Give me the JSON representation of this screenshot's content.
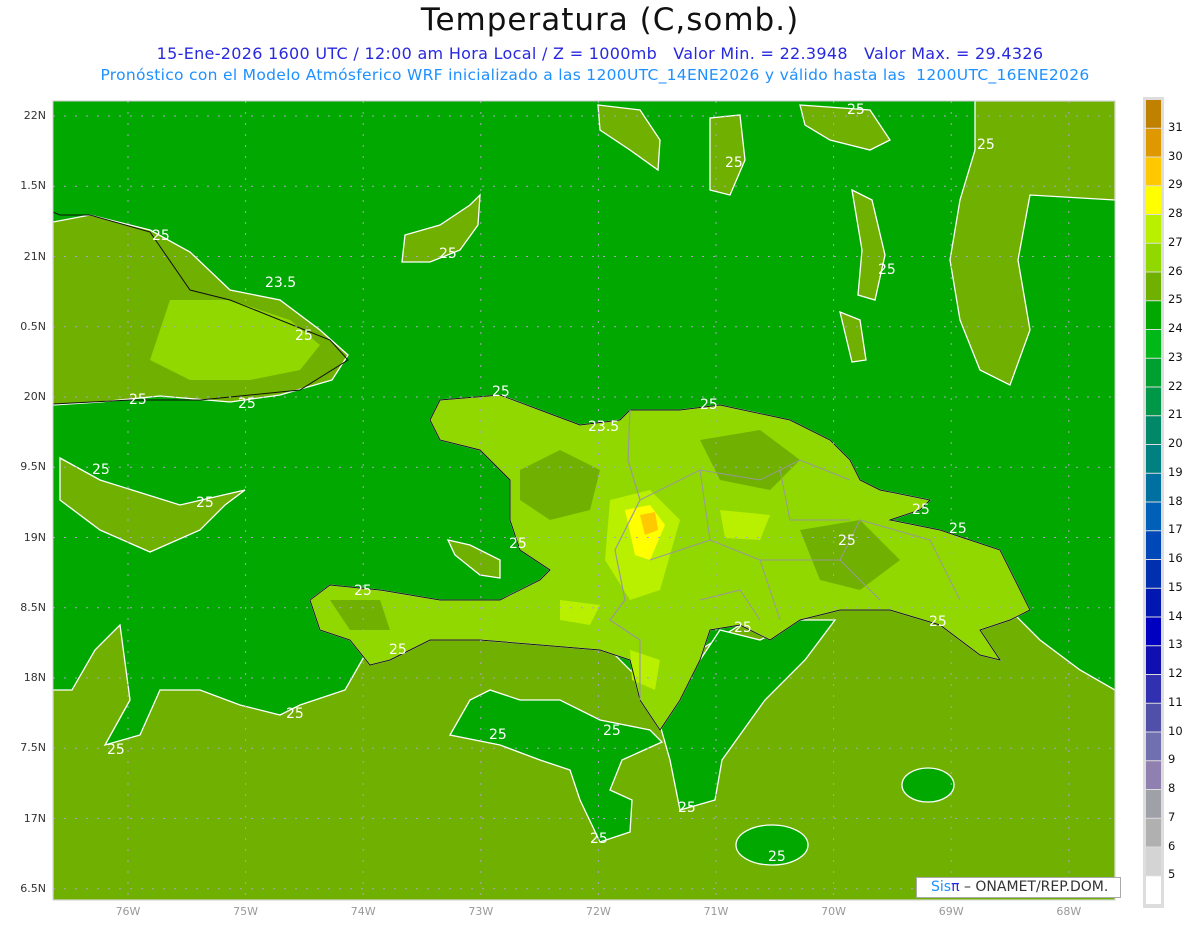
{
  "header": {
    "title": "Temperatura (C,somb.)",
    "line1": "15-Ene-2026 1600 UTC / 12:00 am Hora Local / Z = 1000mb   Valor Min. = 22.3948   Valor Max. = 29.4326",
    "line2": "Pronóstico con el Modelo Atmósferico WRF inicializado a las 1200UTC_14ENE2026 y válido hasta las  1200UTC_16ENE2026"
  },
  "map": {
    "lat_labels": [
      "22N",
      "1.5N",
      "21N",
      "0.5N",
      "20N",
      "9.5N",
      "19N",
      "8.5N",
      "18N",
      "7.5N",
      "17N",
      "6.5N"
    ],
    "lon_labels": [
      "76W",
      "75W",
      "74W",
      "73W",
      "72W",
      "71W",
      "70W",
      "69W",
      "68W"
    ],
    "contour_labels": [
      "25",
      "25",
      "25",
      "25",
      "25",
      "25",
      "25",
      "25",
      "25",
      "25",
      "25",
      "25",
      "25",
      "25",
      "25",
      "25",
      "25",
      "25",
      "25",
      "25",
      "25",
      "25",
      "25",
      "25",
      "25",
      "25",
      "25",
      "25",
      "23.5",
      "23.5"
    ],
    "colors": {
      "ocean_24": "#00a800",
      "field_25": "#70b000",
      "land_26": "#90d800",
      "land_27": "#b8f000",
      "land_28": "#ffff00",
      "land_29": "#ffc800"
    }
  },
  "colorbar": {
    "labels": [
      "31",
      "30",
      "29",
      "28",
      "27",
      "26",
      "25",
      "24",
      "23",
      "22",
      "21",
      "20",
      "19",
      "18",
      "17",
      "16",
      "15",
      "14",
      "13",
      "12",
      "11",
      "10",
      "9",
      "8",
      "7",
      "6",
      "5"
    ],
    "colors": [
      "#c08000",
      "#e09800",
      "#ffc800",
      "#ffff00",
      "#b8f000",
      "#90d800",
      "#70b000",
      "#00a800",
      "#00b818",
      "#00a030",
      "#009848",
      "#008868",
      "#008080",
      "#0070a0",
      "#0060b8",
      "#0048b8",
      "#0030b0",
      "#0018b0",
      "#0000c0",
      "#1010b0",
      "#3030b0",
      "#5050a8",
      "#7070b0",
      "#9080b0",
      "#a0a0a8",
      "#b0b0b0",
      "#d4d4d4",
      "#ffffff"
    ]
  },
  "credit": {
    "sis": "Sis",
    "pi": "π",
    "rest": " – ONAMET/REP.DOM."
  }
}
